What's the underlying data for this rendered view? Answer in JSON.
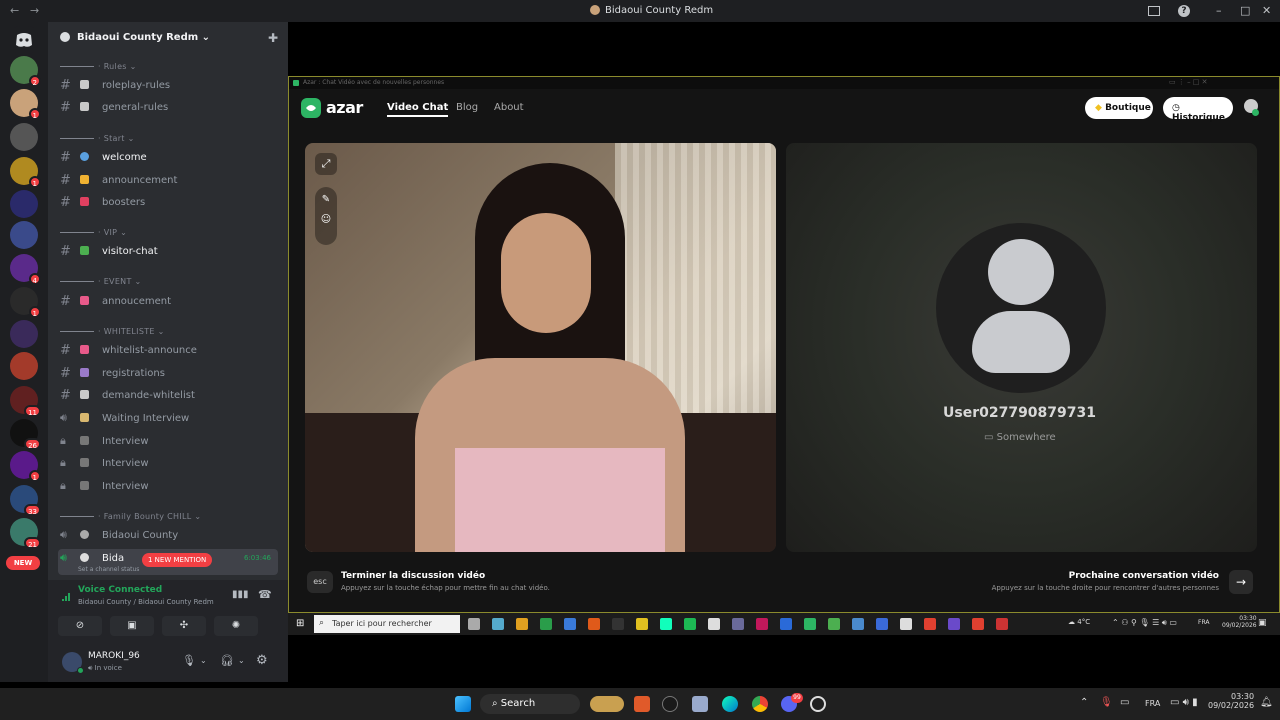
{
  "window": {
    "title": "Bidaoui County Redm",
    "back_arrow": "←",
    "forward_arrow": "→",
    "help": "?",
    "minimize": "–",
    "maximize": "□",
    "close": "✕"
  },
  "rail": {
    "discord_icon": "discord-icon",
    "servers": [
      {
        "color": "#4a7a4a",
        "badge": "2"
      },
      {
        "color": "#c9a27a",
        "badge": "1"
      },
      {
        "color": "#555555",
        "badge": ""
      },
      {
        "color": "#b08a20",
        "badge": "1"
      },
      {
        "color": "#2a2a6a",
        "badge": ""
      },
      {
        "color": "#3a4a8a",
        "badge": ""
      },
      {
        "color": "#5a2a8a",
        "badge": "4"
      },
      {
        "color": "#2a2a2a",
        "badge": "1"
      },
      {
        "color": "#3a2a5a",
        "badge": ""
      },
      {
        "color": "#a33a2a",
        "badge": ""
      },
      {
        "color": "#602020",
        "badge": "11"
      },
      {
        "color": "#111111",
        "badge": "26"
      },
      {
        "color": "#5a1a8a",
        "badge": "1"
      },
      {
        "color": "#2a4a7a",
        "badge": "33"
      },
      {
        "color": "#3a7a6a",
        "badge": "21"
      }
    ],
    "new_label": "NEW"
  },
  "sidebar": {
    "server_name": "Bidaoui County Redm",
    "categories": {
      "rules": "Rules",
      "start": "Start",
      "vip": "VIP",
      "event": "EVENT",
      "whiteliste": "WHITELISTE",
      "family": "Family Bounty CHILL"
    },
    "channels": {
      "roleplay_rules": "roleplay-rules",
      "general_rules": "general-rules",
      "welcome": "welcome",
      "announcement": "announcement",
      "boosters": "boosters",
      "visitor_chat": "visitor-chat",
      "annoucement": "annoucement",
      "whitelist_announce": "whitelist-announce",
      "registrations": "registrations",
      "demande_whitelist": "demande-whitelist",
      "waiting_interview": "Waiting Interview",
      "interview1": "Interview",
      "interview2": "Interview",
      "interview3": "Interview",
      "bidaoui_county": "Bidaoui County",
      "bida_truncated": "Bida",
      "set_status": "Set a channel status",
      "timer": "6:03:46",
      "mention": "1 NEW MENTION"
    },
    "voice": {
      "status": "Voice Connected",
      "location": "Bidaoui County / Bidaoui County Redm"
    },
    "user": {
      "name": "MAROKI_96",
      "status": "In voice"
    }
  },
  "azar": {
    "tab_title": "Azar : Chat Vidéo avec de nouvelles personnes",
    "logo": "azar",
    "nav": {
      "video_chat": "Video Chat",
      "blog": "Blog",
      "about": "About"
    },
    "boutique": "Boutique",
    "historique": "Historique",
    "remote_user": "User027790879731",
    "remote_location": "Somewhere",
    "esc_key": "esc",
    "end_title": "Terminer la discussion vidéo",
    "end_sub": "Appuyez sur la touche échap pour mettre fin au chat vidéo.",
    "next_title": "Prochaine conversation vidéo",
    "next_sub": "Appuyez sur la touche droite pour rencontrer d'autres personnes"
  },
  "inner_taskbar": {
    "search_placeholder": "Taper ici pour rechercher",
    "temp": "4°C",
    "lang": "FRA",
    "time": "03:30",
    "date": "09/02/2026"
  },
  "taskbar": {
    "search": "Search",
    "lang": "FRA",
    "time": "03:30",
    "date": "09/02/2026",
    "discord_badge": "99"
  }
}
